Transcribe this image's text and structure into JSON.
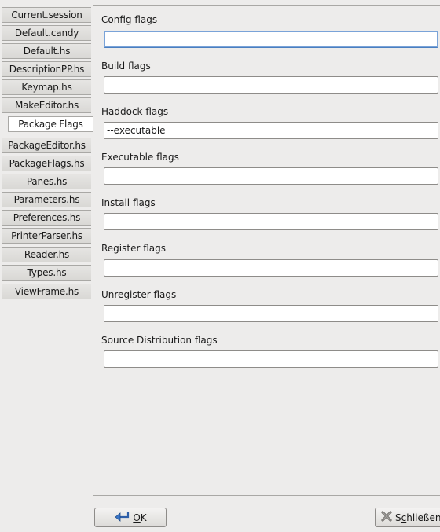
{
  "tabs": [
    {
      "label": "Current.session"
    },
    {
      "label": "Default.candy"
    },
    {
      "label": "Default.hs"
    },
    {
      "label": "DescriptionPP.hs"
    },
    {
      "label": "Keymap.hs"
    },
    {
      "label": "MakeEditor.hs"
    },
    {
      "label": "Package Flags",
      "active": true
    },
    {
      "label": "PackageEditor.hs"
    },
    {
      "label": "PackageFlags.hs"
    },
    {
      "label": "Panes.hs"
    },
    {
      "label": "Parameters.hs"
    },
    {
      "label": "Preferences.hs"
    },
    {
      "label": "PrinterParser.hs"
    },
    {
      "label": "Reader.hs"
    },
    {
      "label": "Types.hs"
    },
    {
      "label": "ViewFrame.hs"
    }
  ],
  "fields": {
    "config": {
      "label": "Config flags",
      "value": ""
    },
    "build": {
      "label": "Build flags",
      "value": ""
    },
    "haddock": {
      "label": "Haddock flags",
      "value": "--executable"
    },
    "executable": {
      "label": "Executable flags",
      "value": ""
    },
    "install": {
      "label": "Install flags",
      "value": ""
    },
    "register": {
      "label": "Register flags",
      "value": ""
    },
    "unregister": {
      "label": "Unregister flags",
      "value": ""
    },
    "sdist": {
      "label": "Source Distribution flags",
      "value": ""
    }
  },
  "buttons": {
    "ok": {
      "mnemonic": "O",
      "rest": "K"
    },
    "close": {
      "pre": "S",
      "mnemonic": "c",
      "rest": "hließen"
    }
  },
  "icons": {
    "ok": "ok-arrow-icon",
    "close": "close-x-icon"
  }
}
